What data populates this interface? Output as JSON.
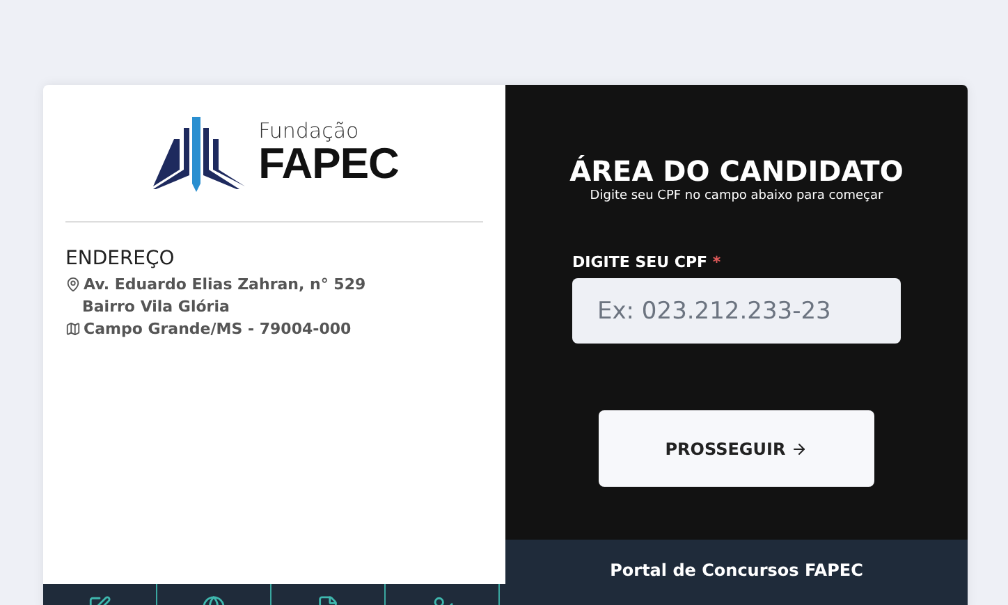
{
  "logo": {
    "line_1": "Fundação",
    "line_2": "FAPEC"
  },
  "address": {
    "heading": "ENDEREÇO",
    "street": "Av. Eduardo Elias Zahran, n° 529",
    "district": "Bairro Vila Glória",
    "city": "Campo Grande/MS - 79004-000"
  },
  "nav_icons": [
    {
      "kind": "edit"
    },
    {
      "kind": "globe"
    },
    {
      "kind": "file"
    },
    {
      "kind": "user"
    }
  ],
  "login": {
    "title": "ÁREA DO CANDIDATO",
    "subtitle": "Digite seu CPF no campo abaixo para começar",
    "field_label": "DIGITE SEU CPF",
    "required_mark": "*",
    "placeholder": "Ex: 023.212.233-23",
    "button": "PROSSEGUIR"
  },
  "footer": {
    "text": "Portal de Concursos FAPEC"
  }
}
